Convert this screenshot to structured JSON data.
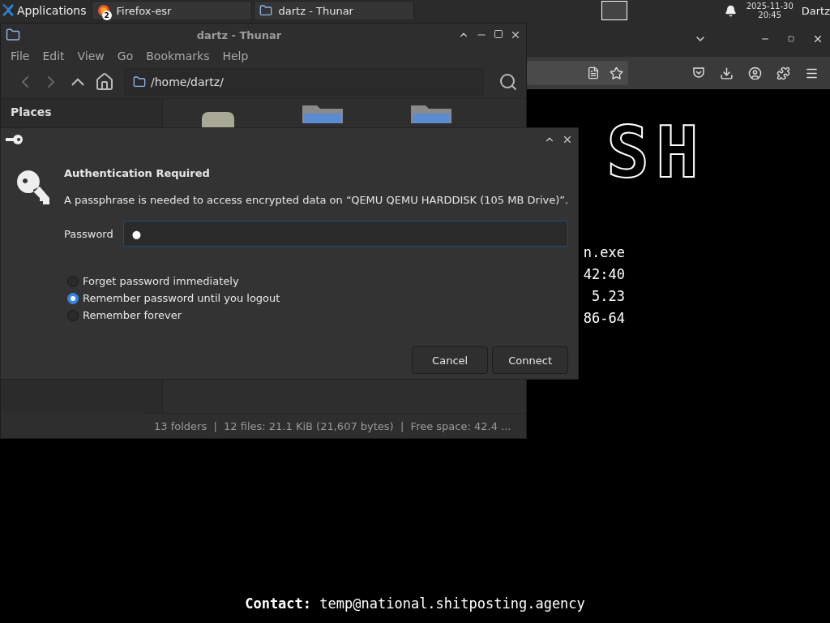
{
  "taskbar": {
    "apps_menu": "Applications",
    "tasks": [
      {
        "label": "Firefox-esr",
        "badge": "2"
      },
      {
        "label": "dartz - Thunar"
      }
    ],
    "clock": {
      "date": "2025-11-30",
      "time": "20:45"
    },
    "user": "Dartz"
  },
  "browser": {
    "logo": "SH",
    "lines": [
      "n.exe",
      "42:40",
      "5.23",
      "86-64"
    ],
    "contact": {
      "label": "Contact:",
      "email": "temp@national.shitposting.agency"
    }
  },
  "file_manager": {
    "title": "dartz - Thunar",
    "menu": [
      "File",
      "Edit",
      "View",
      "Go",
      "Bookmarks",
      "Help"
    ],
    "location": "/home/dartz/",
    "sidebar": {
      "heading": "Places"
    },
    "status_bar": "13 folders  |  12 files: 21.1 KiB (21,607 bytes)  |  Free space: 42.4 ..."
  },
  "dialog": {
    "heading": "Authentication Required",
    "message": "A passphrase is needed to access encrypted data on “QEMU QEMU HARDDISK (105 MB Drive)”.",
    "password": {
      "label": "Password",
      "value": "●"
    },
    "options": [
      {
        "label": "Forget password immediately",
        "selected": false
      },
      {
        "label": "Remember password until you logout",
        "selected": true
      },
      {
        "label": "Remember forever",
        "selected": false
      }
    ],
    "buttons": [
      "Cancel",
      "Connect"
    ]
  }
}
